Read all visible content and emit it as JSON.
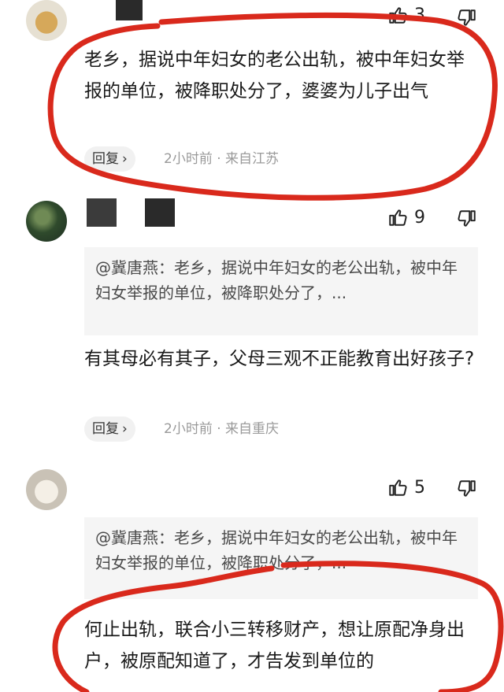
{
  "comments": [
    {
      "likes": "3",
      "text": "老乡，据说中年妇女的老公出轨，被中年妇女举报的单位，被降职处分了，婆婆为儿子出气",
      "reply_label": "回复",
      "time": "2小时前",
      "location": "来自江苏"
    },
    {
      "likes": "9",
      "quote": "@冀唐燕：老乡，据说中年妇女的老公出轨，被中年妇女举报的单位，被降职处分了，...",
      "text": "有其母必有其子，父母三观不正能教育出好孩子?",
      "reply_label": "回复",
      "time": "2小时前",
      "location": "来自重庆"
    },
    {
      "likes": "5",
      "quote": "@冀唐燕：老乡，据说中年妇女的老公出轨，被中年妇女举报的单位，被降职处分了，...",
      "text": "何止出轨，联合小三转移财产，想让原配净身出户，被原配知道了，才告发到单位的"
    }
  ],
  "icons": {
    "like": "thumbs-up-icon",
    "dislike": "thumbs-down-icon",
    "reply_chevron": "chevron-right-icon"
  },
  "colors": {
    "annotation": "#d9291c",
    "quote_bg": "#f5f5f5"
  }
}
